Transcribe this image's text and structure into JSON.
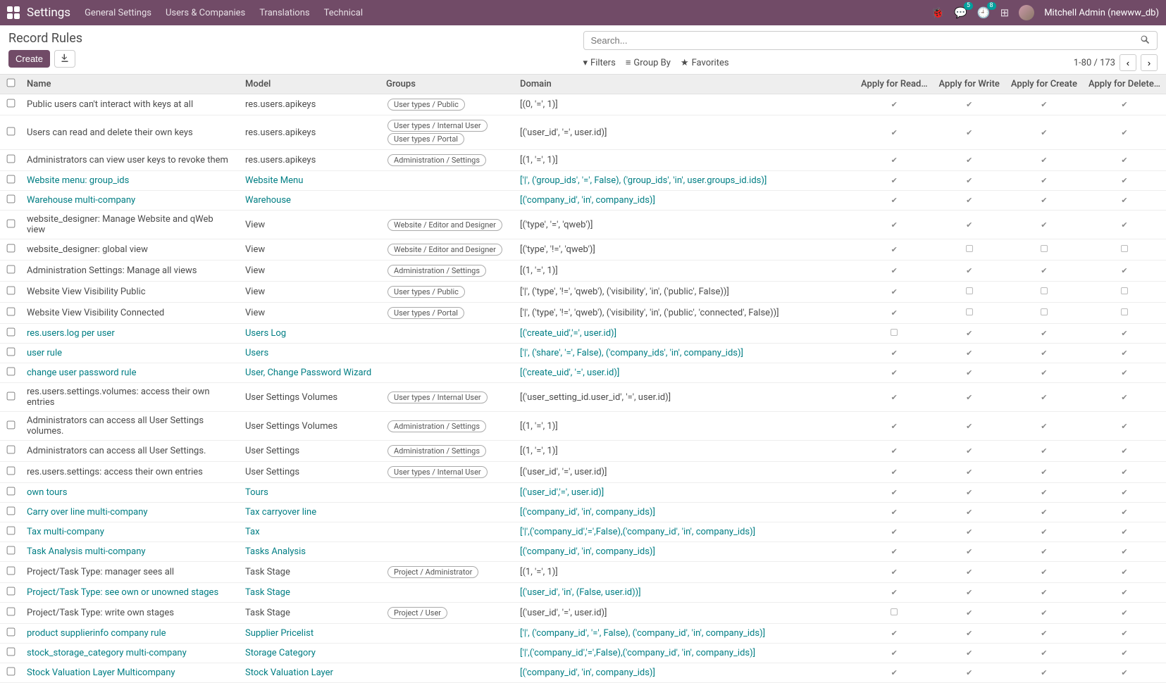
{
  "topbar": {
    "app_title": "Settings",
    "menu": [
      "General Settings",
      "Users & Companies",
      "Translations",
      "Technical"
    ],
    "messaging_badge": "5",
    "activity_badge": "8",
    "user_name": "Mitchell Admin (newww_db)"
  },
  "page_title": "Record Rules",
  "toolbar": {
    "create_label": "Create",
    "search_placeholder": "Search...",
    "filters_label": "Filters",
    "groupby_label": "Group By",
    "favorites_label": "Favorites",
    "pager_text": "1-80 / 173"
  },
  "columns": {
    "name": "Name",
    "model": "Model",
    "groups": "Groups",
    "domain": "Domain",
    "read": "Apply for Read…",
    "write": "Apply for Write",
    "create": "Apply for Create",
    "delete": "Apply for Delete…"
  },
  "rows": [
    {
      "name": "Public users can't interact with keys at all",
      "model": "res.users.apikeys",
      "name_link": false,
      "model_link": false,
      "domain_link": false,
      "groups": [
        "User types / Public"
      ],
      "domain": "[(0, '=', 1)]",
      "r": true,
      "w": true,
      "c": true,
      "d": true
    },
    {
      "name": "Users can read and delete their own keys",
      "model": "res.users.apikeys",
      "name_link": false,
      "model_link": false,
      "domain_link": false,
      "groups": [
        "User types / Internal User",
        "User types / Portal"
      ],
      "domain": "[('user_id', '=', user.id)]",
      "r": true,
      "w": true,
      "c": true,
      "d": true
    },
    {
      "name": "Administrators can view user keys to revoke them",
      "model": "res.users.apikeys",
      "name_link": false,
      "model_link": false,
      "domain_link": false,
      "groups": [
        "Administration / Settings"
      ],
      "domain": "[(1, '=', 1)]",
      "r": true,
      "w": true,
      "c": true,
      "d": true
    },
    {
      "name": "Website menu: group_ids",
      "model": "Website Menu",
      "name_link": true,
      "model_link": true,
      "domain_link": true,
      "groups": [],
      "domain": "['|', ('group_ids', '=', False), ('group_ids', 'in', user.groups_id.ids)]",
      "r": true,
      "w": true,
      "c": true,
      "d": true
    },
    {
      "name": "Warehouse multi-company",
      "model": "Warehouse",
      "name_link": true,
      "model_link": true,
      "domain_link": true,
      "groups": [],
      "domain": "[('company_id', 'in', company_ids)]",
      "r": true,
      "w": true,
      "c": true,
      "d": true
    },
    {
      "name": "website_designer: Manage Website and qWeb view",
      "model": "View",
      "name_link": false,
      "model_link": false,
      "domain_link": false,
      "groups": [
        "Website / Editor and Designer"
      ],
      "domain": "[('type', '=', 'qweb')]",
      "r": true,
      "w": true,
      "c": true,
      "d": true
    },
    {
      "name": "website_designer: global view",
      "model": "View",
      "name_link": false,
      "model_link": false,
      "domain_link": false,
      "groups": [
        "Website / Editor and Designer"
      ],
      "domain": "[('type', '!=', 'qweb')]",
      "r": true,
      "w": false,
      "c": false,
      "d": false
    },
    {
      "name": "Administration Settings: Manage all views",
      "model": "View",
      "name_link": false,
      "model_link": false,
      "domain_link": false,
      "groups": [
        "Administration / Settings"
      ],
      "domain": "[(1, '=', 1)]",
      "r": true,
      "w": true,
      "c": true,
      "d": true
    },
    {
      "name": "Website View Visibility Public",
      "model": "View",
      "name_link": false,
      "model_link": false,
      "domain_link": false,
      "groups": [
        "User types / Public"
      ],
      "domain": "['|', ('type', '!=', 'qweb'), ('visibility', 'in', ('public', False))]",
      "r": true,
      "w": false,
      "c": false,
      "d": false
    },
    {
      "name": "Website View Visibility Connected",
      "model": "View",
      "name_link": false,
      "model_link": false,
      "domain_link": false,
      "groups": [
        "User types / Portal"
      ],
      "domain": "['|', ('type', '!=', 'qweb'), ('visibility', 'in', ('public', 'connected', False))]",
      "r": true,
      "w": false,
      "c": false,
      "d": false
    },
    {
      "name": "res.users.log per user",
      "model": "Users Log",
      "name_link": true,
      "model_link": true,
      "domain_link": true,
      "groups": [],
      "domain": "[('create_uid','=', user.id)]",
      "r": false,
      "w": true,
      "c": true,
      "d": true
    },
    {
      "name": "user rule",
      "model": "Users",
      "name_link": true,
      "model_link": true,
      "domain_link": true,
      "groups": [],
      "domain": "['|', ('share', '=', False), ('company_ids', 'in', company_ids)]",
      "r": true,
      "w": true,
      "c": true,
      "d": true
    },
    {
      "name": "change user password rule",
      "model": "User, Change Password Wizard",
      "name_link": true,
      "model_link": true,
      "domain_link": true,
      "groups": [],
      "domain": "[('create_uid', '=', user.id)]",
      "r": true,
      "w": true,
      "c": true,
      "d": true
    },
    {
      "name": "res.users.settings.volumes: access their own entries",
      "model": "User Settings Volumes",
      "name_link": false,
      "model_link": false,
      "domain_link": false,
      "groups": [
        "User types / Internal User"
      ],
      "domain": "[('user_setting_id.user_id', '=', user.id)]",
      "r": true,
      "w": true,
      "c": true,
      "d": true
    },
    {
      "name": "Administrators can access all User Settings volumes.",
      "model": "User Settings Volumes",
      "name_link": false,
      "model_link": false,
      "domain_link": false,
      "groups": [
        "Administration / Settings"
      ],
      "domain": "[(1, '=', 1)]",
      "r": true,
      "w": true,
      "c": true,
      "d": true
    },
    {
      "name": "Administrators can access all User Settings.",
      "model": "User Settings",
      "name_link": false,
      "model_link": false,
      "domain_link": false,
      "groups": [
        "Administration / Settings"
      ],
      "domain": "[(1, '=', 1)]",
      "r": true,
      "w": true,
      "c": true,
      "d": true
    },
    {
      "name": "res.users.settings: access their own entries",
      "model": "User Settings",
      "name_link": false,
      "model_link": false,
      "domain_link": false,
      "groups": [
        "User types / Internal User"
      ],
      "domain": "[('user_id', '=', user.id)]",
      "r": true,
      "w": true,
      "c": true,
      "d": true
    },
    {
      "name": "own tours",
      "model": "Tours",
      "name_link": true,
      "model_link": true,
      "domain_link": true,
      "groups": [],
      "domain": "[('user_id','=', user.id)]",
      "r": true,
      "w": true,
      "c": true,
      "d": true
    },
    {
      "name": "Carry over line multi-company",
      "model": "Tax carryover line",
      "name_link": true,
      "model_link": true,
      "domain_link": true,
      "groups": [],
      "domain": "[('company_id', 'in', company_ids)]",
      "r": true,
      "w": true,
      "c": true,
      "d": true
    },
    {
      "name": "Tax multi-company",
      "model": "Tax",
      "name_link": true,
      "model_link": true,
      "domain_link": true,
      "groups": [],
      "domain": "['|',('company_id','=',False),('company_id', 'in', company_ids)]",
      "r": true,
      "w": true,
      "c": true,
      "d": true
    },
    {
      "name": "Task Analysis multi-company",
      "model": "Tasks Analysis",
      "name_link": true,
      "model_link": true,
      "domain_link": true,
      "groups": [],
      "domain": "[('company_id', 'in', company_ids)]",
      "r": true,
      "w": true,
      "c": true,
      "d": true
    },
    {
      "name": "Project/Task Type: manager sees all",
      "model": "Task Stage",
      "name_link": false,
      "model_link": false,
      "domain_link": false,
      "groups": [
        "Project / Administrator"
      ],
      "domain": "[(1, '=', 1)]",
      "r": true,
      "w": true,
      "c": true,
      "d": true
    },
    {
      "name": "Project/Task Type: see own or unowned stages",
      "model": "Task Stage",
      "name_link": true,
      "model_link": true,
      "domain_link": true,
      "groups": [],
      "domain": "[('user_id', 'in', (False, user.id))]",
      "r": true,
      "w": true,
      "c": true,
      "d": true
    },
    {
      "name": "Project/Task Type: write own stages",
      "model": "Task Stage",
      "name_link": false,
      "model_link": false,
      "domain_link": false,
      "groups": [
        "Project / User"
      ],
      "domain": "[('user_id', '=', user.id)]",
      "r": false,
      "w": true,
      "c": true,
      "d": true
    },
    {
      "name": "product supplierinfo company rule",
      "model": "Supplier Pricelist",
      "name_link": true,
      "model_link": true,
      "domain_link": true,
      "groups": [],
      "domain": "['|', ('company_id', '=', False), ('company_id', 'in', company_ids)]",
      "r": true,
      "w": true,
      "c": true,
      "d": true
    },
    {
      "name": "stock_storage_category multi-company",
      "model": "Storage Category",
      "name_link": true,
      "model_link": true,
      "domain_link": true,
      "groups": [],
      "domain": "['|',('company_id','=',False),('company_id', 'in', company_ids)]",
      "r": true,
      "w": true,
      "c": true,
      "d": true
    },
    {
      "name": "Stock Valuation Layer Multicompany",
      "model": "Stock Valuation Layer",
      "name_link": true,
      "model_link": true,
      "domain_link": true,
      "groups": [],
      "domain": "[('company_id', 'in', company_ids)]",
      "r": true,
      "w": true,
      "c": true,
      "d": true
    }
  ]
}
